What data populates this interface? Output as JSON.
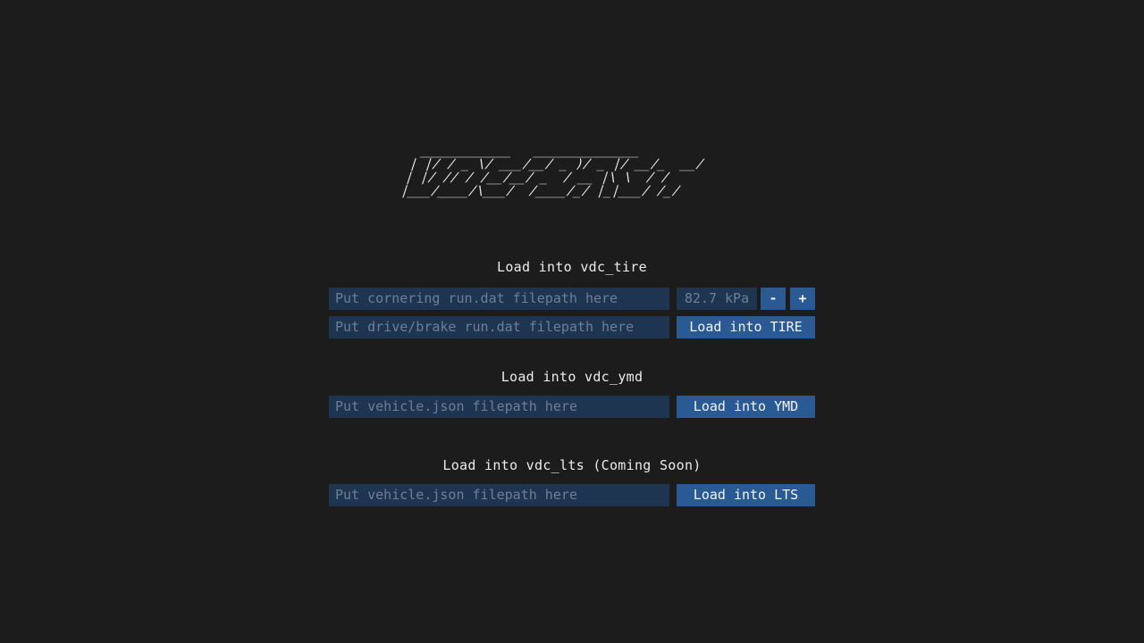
{
  "logo": {
    "art": " ____________   ______________\n| |/ / _ \\/ ___/__/ _ )/ _ |/ __/_  __/\n| |/ // / /__/__/ _  / __ |\\ \\  / /\n|___/____/\\___/  /____/_/ |_|___/ /_/"
  },
  "tire": {
    "title": "Load into vdc_tire",
    "cornering_placeholder": "Put cornering run.dat filepath here",
    "drive_placeholder": "Put drive/brake run.dat filepath here",
    "pressure_value": "82.7 kPa",
    "minus_label": "-",
    "plus_label": "+",
    "load_label": "Load into TIRE"
  },
  "ymd": {
    "title": "Load into vdc_ymd",
    "placeholder": "Put vehicle.json filepath here",
    "load_label": "Load into YMD"
  },
  "lts": {
    "title": "Load into vdc_lts (Coming Soon)",
    "placeholder": "Put vehicle.json filepath here",
    "load_label": "Load into LTS"
  },
  "colors": {
    "background": "#1c1c1c",
    "input_bg": "#1e3552",
    "button_bg": "#2a5a94",
    "placeholder_text": "#6e7f95"
  }
}
